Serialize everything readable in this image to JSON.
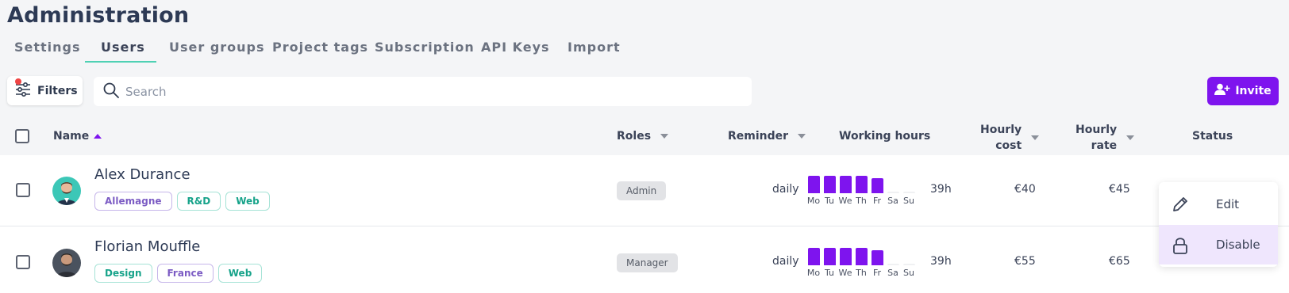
{
  "page": {
    "title": "Administration"
  },
  "tabs": [
    {
      "label": "Settings",
      "active": false
    },
    {
      "label": "Users",
      "active": true
    },
    {
      "label": "User groups",
      "active": false
    },
    {
      "label": "Project tags",
      "active": false
    },
    {
      "label": "Subscription",
      "active": false
    },
    {
      "label": "API Keys",
      "active": false
    },
    {
      "label": "Import",
      "active": false
    }
  ],
  "toolbar": {
    "filters_label": "Filters",
    "search_placeholder": "Search",
    "invite_label": "Invite"
  },
  "columns": {
    "name": "Name",
    "roles": "Roles",
    "reminder": "Reminder",
    "working_hours": "Working hours",
    "hourly_cost_line1": "Hourly",
    "hourly_cost_line2": "cost",
    "hourly_rate_line1": "Hourly",
    "hourly_rate_line2": "rate",
    "status": "Status"
  },
  "days": [
    "Mo",
    "Tu",
    "We",
    "Th",
    "Fr",
    "Sa",
    "Su"
  ],
  "users": [
    {
      "name": "Alex Durance",
      "tags": [
        {
          "label": "Allemagne",
          "color": "#7c5cc4"
        },
        {
          "label": "R&D",
          "color": "#17a38a"
        },
        {
          "label": "Web",
          "color": "#17a38a"
        }
      ],
      "role": "Admin",
      "reminder": "daily",
      "daily_hours": [
        8,
        8,
        8,
        8,
        7,
        0,
        0
      ],
      "total_hours": "39h",
      "hourly_cost": "€40",
      "hourly_rate": "€45"
    },
    {
      "name": "Florian Mouffle",
      "tags": [
        {
          "label": "Design",
          "color": "#17a38a"
        },
        {
          "label": "France",
          "color": "#7c5cc4"
        },
        {
          "label": "Web",
          "color": "#17a38a"
        }
      ],
      "role": "Manager",
      "reminder": "daily",
      "daily_hours": [
        8,
        8,
        8,
        8,
        7,
        0,
        0
      ],
      "total_hours": "39h",
      "hourly_cost": "€55",
      "hourly_rate": "€65"
    }
  ],
  "context_menu": {
    "items": [
      {
        "label": "Edit",
        "icon": "pencil-icon"
      },
      {
        "label": "Disable",
        "icon": "lock-icon"
      }
    ]
  },
  "colors": {
    "accent": "#7e14ee",
    "tab_underline": "#4fd1b4",
    "filter_dot": "#ef4444"
  }
}
